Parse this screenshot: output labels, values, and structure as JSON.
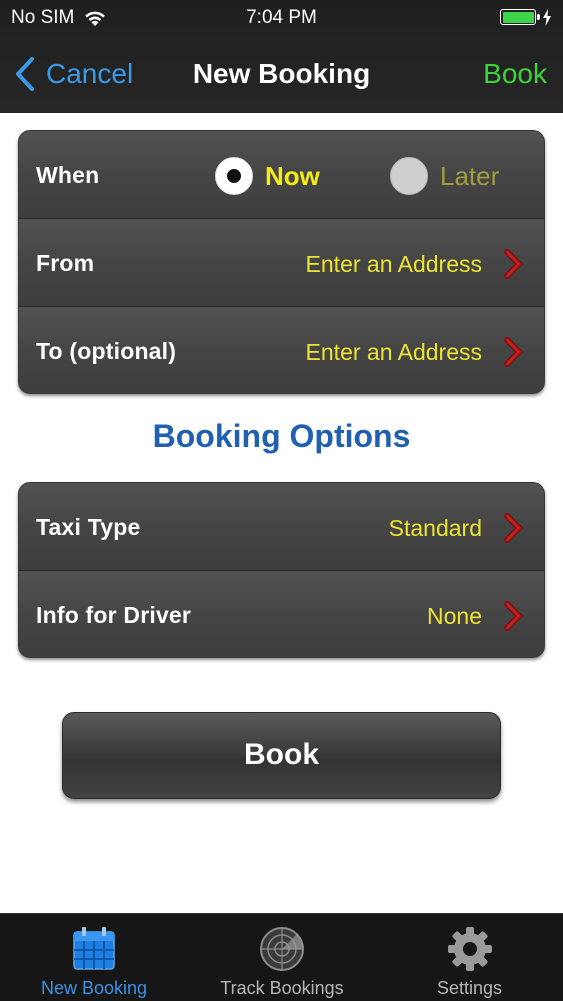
{
  "status_bar": {
    "carrier": "No SIM",
    "time": "7:04 PM"
  },
  "nav": {
    "back_label": "Cancel",
    "title": "New Booking",
    "action_label": "Book"
  },
  "trip": {
    "when": {
      "label": "When",
      "options": [
        "Now",
        "Later"
      ],
      "selected": "Now"
    },
    "from": {
      "label": "From",
      "value": "Enter an Address"
    },
    "to": {
      "label": "To (optional)",
      "value": "Enter an Address"
    }
  },
  "options_section": {
    "title": "Booking Options",
    "taxi_type": {
      "label": "Taxi Type",
      "value": "Standard"
    },
    "driver_info": {
      "label": "Info for Driver",
      "value": "None"
    }
  },
  "book_button": {
    "label": "Book"
  },
  "tabs": [
    {
      "label": "New Booking",
      "icon": "calendar-icon",
      "active": true
    },
    {
      "label": "Track Bookings",
      "icon": "radar-icon",
      "active": false
    },
    {
      "label": "Settings",
      "icon": "gear-icon",
      "active": false
    }
  ],
  "colors": {
    "accent_blue": "#3b9ae8",
    "action_green": "#39d43a",
    "value_yellow": "#ece430",
    "section_title_blue": "#2060b0"
  }
}
